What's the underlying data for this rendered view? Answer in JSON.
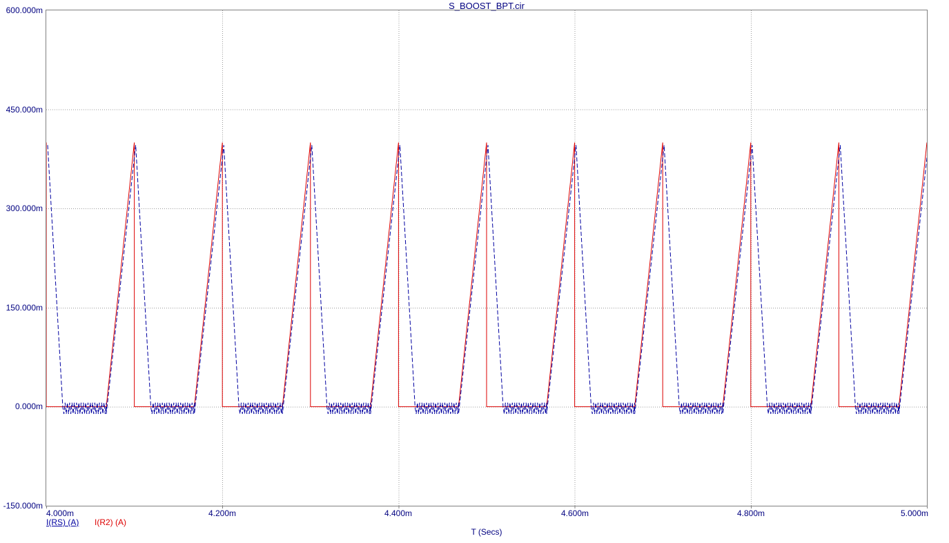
{
  "window": {
    "title": "S_BOOST_BPT.cir"
  },
  "chart_data": {
    "type": "line",
    "title": "S_BOOST_BPT.cir",
    "xlabel": "T (Secs)",
    "ylabel": "",
    "xlim_ms": [
      4.0,
      5.0
    ],
    "ylim_A": [
      -0.15,
      0.6
    ],
    "x_ticks": {
      "labels": [
        "4.000m",
        "4.200m",
        "4.400m",
        "4.600m",
        "4.800m",
        "5.000m"
      ],
      "values_ms": [
        4.0,
        4.2,
        4.4,
        4.6,
        4.8,
        5.0
      ]
    },
    "y_ticks": {
      "labels": [
        "600.000m",
        "450.000m",
        "300.000m",
        "150.000m",
        "0.000m",
        "-150.000m"
      ],
      "values_A": [
        0.6,
        0.45,
        0.3,
        0.15,
        0.0,
        -0.15
      ]
    },
    "grid": {
      "style": "dotted",
      "color": "#9A9A9A",
      "border_color": "#808080",
      "background": "#FFFFFF"
    },
    "legend_position": "bottom-left",
    "series": [
      {
        "name": "I(RS) (A)",
        "color": "#0000A0",
        "line_style": "dashed",
        "selected": true,
        "waveform": {
          "shape": "switch_current",
          "description": "Falls from peak to 0 over first 19% of each period, rings around 0 until 68%, then ramps linearly back to peak.",
          "start_ms": 4.0,
          "period_ms": 0.1,
          "periods": 10,
          "peak_A": 0.396,
          "fall_end_frac": 0.188,
          "ring_end_frac": 0.682,
          "ring_top_A": 0.006,
          "ring_bottom_A": -0.011,
          "ring_halfstep_ms": 0.0013
        }
      },
      {
        "name": "I(R2) (A)",
        "color": "#DD0000",
        "line_style": "solid",
        "selected": false,
        "waveform": {
          "shape": "sawtooth",
          "description": "Holds at 0 for first 68% of each period, ramps linearly to peak by end of period, then drops instantly to 0.",
          "start_ms": 4.0,
          "period_ms": 0.1,
          "periods": 10,
          "peak_A": 0.4,
          "rise_start_frac": 0.682
        }
      }
    ]
  }
}
